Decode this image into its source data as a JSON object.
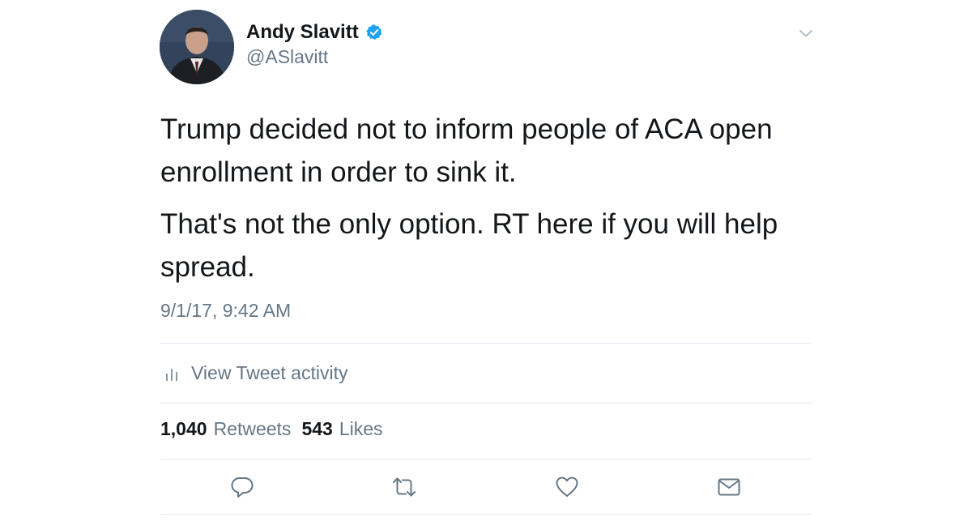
{
  "author": {
    "display_name": "Andy Slavitt",
    "handle": "@ASlavitt",
    "verified": true
  },
  "tweet": {
    "paragraphs": [
      "Trump decided not to inform people of ACA open enrollment in order to sink it.",
      "That's not the only option. RT here if you will help spread."
    ],
    "timestamp": "9/1/17, 9:42 AM"
  },
  "activity": {
    "label": "View Tweet activity",
    "icon": "bar-chart-icon"
  },
  "stats": {
    "retweets_count": "1,040",
    "retweets_label": "Retweets",
    "likes_count": "543",
    "likes_label": "Likes"
  },
  "actions": [
    {
      "name": "reply",
      "icon": "reply-icon"
    },
    {
      "name": "retweet",
      "icon": "retweet-icon"
    },
    {
      "name": "like",
      "icon": "heart-icon"
    },
    {
      "name": "direct-message",
      "icon": "envelope-icon"
    }
  ],
  "colors": {
    "primary_text": "#14171a",
    "secondary_text": "#657786",
    "verified_blue": "#1da1f2",
    "divider": "#e1e8ed"
  }
}
